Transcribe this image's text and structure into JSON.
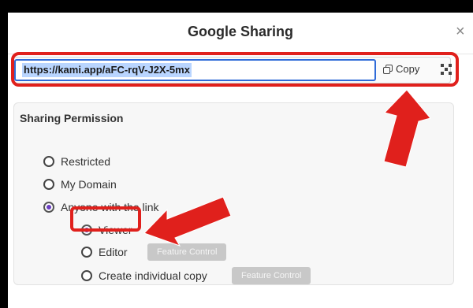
{
  "dialog": {
    "title": "Google Sharing",
    "close_glyph": "×"
  },
  "link": {
    "url": "https://kami.app/aFC-rqV-J2X-5mx",
    "copy_label": "Copy",
    "copy_icon": "copy-icon",
    "qr_icon": "qr-code-icon"
  },
  "permission": {
    "title": "Sharing Permission",
    "options": [
      {
        "label": "Restricted",
        "selected": false
      },
      {
        "label": "My Domain",
        "selected": false
      },
      {
        "label": "Anyone with the link",
        "selected": true
      }
    ],
    "sub_options": [
      {
        "label": "Viewer",
        "selected": true
      },
      {
        "label": "Editor",
        "selected": false,
        "button": "Feature Control"
      },
      {
        "label": "Create individual copy",
        "selected": false,
        "button": "Feature Control"
      }
    ]
  },
  "colors": {
    "annotation_red": "#e0201c",
    "radio_accent": "#6a3fc1",
    "input_focus": "#2f6bd8"
  }
}
